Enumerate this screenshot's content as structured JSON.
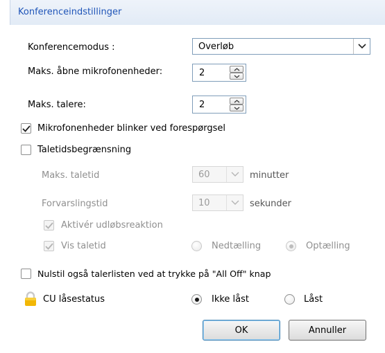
{
  "window": {
    "title": "Konferenceindstillinger"
  },
  "conference_mode": {
    "label": "Konferencemodus :",
    "value": "Overløb"
  },
  "max_open_mics": {
    "label": "Maks. åbne mikrofonenheder:",
    "value": "2"
  },
  "max_speakers": {
    "label": "Maks. talere:",
    "value": "2"
  },
  "mic_blink": {
    "label": "Mikrofonenheder blinker ved forespørgsel",
    "checked": true
  },
  "speech_limit": {
    "label": "Taletidsbegrænsning",
    "checked": false
  },
  "max_speech_time": {
    "label": "Maks. taletid",
    "value": "60",
    "unit": "minutter"
  },
  "warning_time": {
    "label": "Forvarslingstid",
    "value": "10",
    "unit": "sekunder"
  },
  "expiry_reaction": {
    "label": "Aktivér udløbsreaktion",
    "checked": true
  },
  "show_speech_time": {
    "label": "Vis taletid",
    "checked": true,
    "options": [
      "Nedtælling",
      "Optælling"
    ],
    "selected": "Optælling"
  },
  "reset_list": {
    "label": "Nulstil også talerlisten ved at trykke på \"All Off\" knap",
    "checked": false
  },
  "cu_lock": {
    "label": "CU låsestatus",
    "options": [
      "Ikke låst",
      "Låst"
    ],
    "selected": "Ikke låst"
  },
  "buttons": {
    "ok": "OK",
    "cancel": "Annuller"
  },
  "colors": {
    "title": "#1f55b8",
    "disabled": "#8f8f8f",
    "lock": "#f2b705"
  }
}
